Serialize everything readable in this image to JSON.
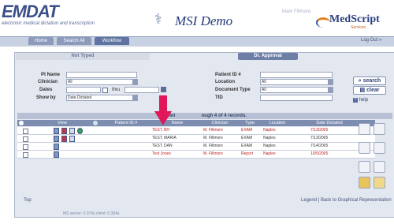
{
  "header": {
    "logo": "EMDAT",
    "tagline": "electronic medical dictation and transcription",
    "demo_name": "MSI Demo",
    "user_name": "Mark Fillmore",
    "brand": "MedScript",
    "brand_sub": "Services"
  },
  "nav": {
    "tabs": [
      "Home",
      "Search All",
      "Workflow"
    ],
    "logout": "Log Out »"
  },
  "status_tabs": {
    "not_typed": "Not Typed",
    "dr_approval": "Dr. Approval"
  },
  "filters": {
    "pt_name_label": "Pt Name",
    "clinician_label": "Clinician",
    "clinician_value": "All",
    "dates_label": "Dates",
    "thru_label": "thru",
    "show_by_label": "Show by",
    "show_by_value": "Date Dictated",
    "patient_id_label": "Patient ID #",
    "location_label": "Location",
    "location_value": "All",
    "doc_type_label": "Document Type",
    "doc_type_value": "All",
    "tid_label": "TID"
  },
  "buttons": {
    "search": "search",
    "clear": "clear",
    "help": "help"
  },
  "grid": {
    "title_left": "Viewi",
    "title_right": "ough 4 of 4 records.",
    "columns": [
      "View",
      "Patient ID #",
      "Name",
      "Clinician",
      "Type",
      "Location",
      "Date Dictated"
    ],
    "rows": [
      {
        "name": "TEST, BH",
        "clinician": "M. Fillmore",
        "type": "EXAM",
        "location": "Naples",
        "date": "7/13/2005",
        "red": true
      },
      {
        "name": "TEST, MARIA",
        "clinician": "M. Fillmore",
        "type": "EXAM",
        "location": "Naples",
        "date": "7/13/2005",
        "red": false
      },
      {
        "name": "TEST, DAN",
        "clinician": "M. Fillmore",
        "type": "EXAM",
        "location": "Naples",
        "date": "7/14/2005",
        "red": false
      },
      {
        "name": "Test Jones",
        "clinician": "M. Fillmore",
        "type": "Report",
        "location": "Naples",
        "date": "10/5/2005",
        "red": true
      }
    ]
  },
  "footer": {
    "top": "Top",
    "legend": "Legend",
    "separator": "|",
    "back": "Back to Graphical Representation",
    "server_info": "MS server: 0.074s   client: 0.304s"
  },
  "colors": {
    "accent": "#5f74a0",
    "arrow": "#e0185a"
  }
}
